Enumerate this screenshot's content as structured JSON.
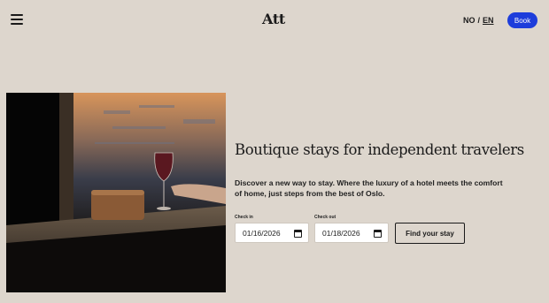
{
  "header": {
    "menu_icon": "hamburger-menu-icon",
    "logo": "Att",
    "lang": {
      "no": "NO",
      "separator": "/",
      "en": "EN"
    },
    "book_label": "Book",
    "book_color": "#1d3ddb"
  },
  "hero": {
    "image": "hotel-bar-wine-glass-photo",
    "headline": "Boutique stays for independent travelers",
    "intro": "Discover a new way to stay. Where the luxury of a hotel meets the comfort of home, just steps from the best of Oslo."
  },
  "booking": {
    "checkin_label": "Check in",
    "checkin_value": "01/16/2026",
    "checkout_label": "Check out",
    "checkout_value": "01/18/2026",
    "calendar_icon": "calendar-icon",
    "submit_label": "Find your stay"
  },
  "colors": {
    "background": "#ddd6cd",
    "accent": "#1d3ddb",
    "text": "#1a1a1a"
  }
}
